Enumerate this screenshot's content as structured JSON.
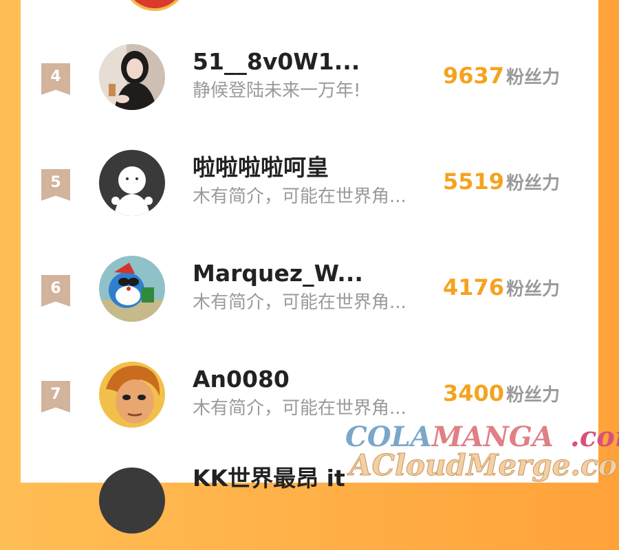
{
  "ranking": {
    "unit_label": "粉丝力",
    "rows": [
      {
        "rank": "4",
        "name": "51__8v0W1...",
        "bio": "静候登陆未来一万年!",
        "score": "9637",
        "avatar": "girl-photo-avatar"
      },
      {
        "rank": "5",
        "name": "啦啦啦啦呵皇",
        "bio": "木有简介，可能在世界角...",
        "score": "5519",
        "avatar": "default-avatar"
      },
      {
        "rank": "6",
        "name": "Marquez_W...",
        "bio": "木有简介，可能在世界角...",
        "score": "4176",
        "avatar": "doraemon-avatar"
      },
      {
        "rank": "7",
        "name": "An0080",
        "bio": "木有简介，可能在世界角...",
        "score": "3400",
        "avatar": "cartoon-boy-avatar"
      },
      {
        "rank": "",
        "name": "KK世界最昂 it",
        "bio": "",
        "score": "",
        "avatar": "partial-avatar"
      }
    ]
  },
  "watermark": {
    "line1_a": "COLA",
    "line1_b": "MANGA",
    "line1_c": ".com",
    "line2": "ACloudMerge.com"
  },
  "colors": {
    "background": "#ffa23a",
    "score": "#f4a320",
    "rank_badge": "#d2b39c",
    "name": "#222222",
    "secondary": "#9a9a9a"
  }
}
